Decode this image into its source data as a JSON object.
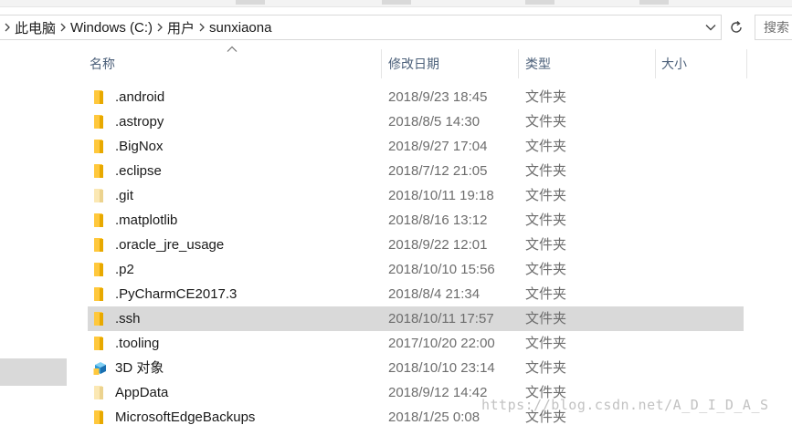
{
  "address_bar": {
    "crumbs": [
      "此电脑",
      "Windows (C:)",
      "用户",
      "sunxiaona"
    ]
  },
  "search": {
    "placeholder": "搜索"
  },
  "columns": {
    "name": "名称",
    "date": "修改日期",
    "type": "类型",
    "size": "大小"
  },
  "files": [
    {
      "name": ".android",
      "date": "2018/9/23 18:45",
      "type": "文件夹",
      "icon": "folder-icon"
    },
    {
      "name": ".astropy",
      "date": "2018/8/5 14:30",
      "type": "文件夹",
      "icon": "folder-icon"
    },
    {
      "name": ".BigNox",
      "date": "2018/9/27 17:04",
      "type": "文件夹",
      "icon": "folder-icon"
    },
    {
      "name": ".eclipse",
      "date": "2018/7/12 21:05",
      "type": "文件夹",
      "icon": "folder-icon"
    },
    {
      "name": ".git",
      "date": "2018/10/11 19:18",
      "type": "文件夹",
      "icon": "hidden-folder-icon"
    },
    {
      "name": ".matplotlib",
      "date": "2018/8/16 13:12",
      "type": "文件夹",
      "icon": "folder-icon"
    },
    {
      "name": ".oracle_jre_usage",
      "date": "2018/9/22 12:01",
      "type": "文件夹",
      "icon": "folder-icon"
    },
    {
      "name": ".p2",
      "date": "2018/10/10 15:56",
      "type": "文件夹",
      "icon": "folder-icon"
    },
    {
      "name": ".PyCharmCE2017.3",
      "date": "2018/8/4 21:34",
      "type": "文件夹",
      "icon": "folder-icon"
    },
    {
      "name": ".ssh",
      "date": "2018/10/11 17:57",
      "type": "文件夹",
      "icon": "folder-icon",
      "selected": true
    },
    {
      "name": ".tooling",
      "date": "2017/10/20 22:00",
      "type": "文件夹",
      "icon": "folder-icon"
    },
    {
      "name": "3D 对象",
      "date": "2018/10/10 23:14",
      "type": "文件夹",
      "icon": "3d-objects-icon"
    },
    {
      "name": "AppData",
      "date": "2018/9/12 14:42",
      "type": "文件夹",
      "icon": "hidden-folder-icon"
    },
    {
      "name": "MicrosoftEdgeBackups",
      "date": "2018/1/25 0:08",
      "type": "文件夹",
      "icon": "folder-icon"
    }
  ],
  "colors": {
    "folder": "#ffc83d",
    "folder_dark": "#e8a900",
    "folder_hidden": "#fbe8b4",
    "selected_row": "#d9d9d9",
    "header_text": "#4c607a"
  },
  "watermark": "https://blog.csdn.net/A_D_I_D_A_S"
}
